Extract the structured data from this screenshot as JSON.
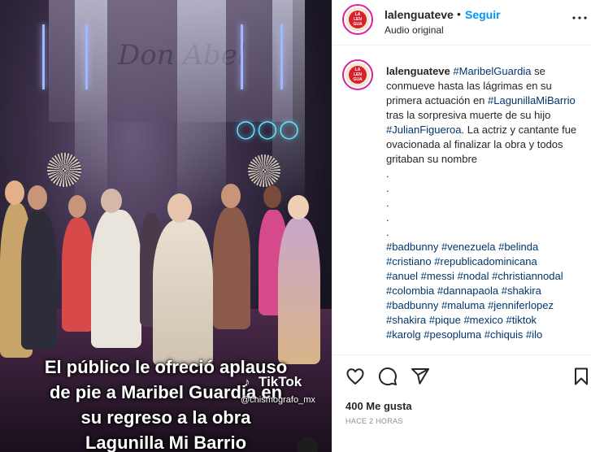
{
  "post": {
    "username": "lalenguateve",
    "follow_label": "Seguir",
    "audio_label": "Audio original",
    "caption_body": " se conmueve hasta las lágrimas en su primera actuación en ",
    "caption_mid": " tras la sorpresiva muerte de su hijo ",
    "caption_end": ". La actriz y cantante fue ovacionada al finalizar la obra y todos gritaban su nombre",
    "tag_maribel": "#MaribelGuardia",
    "tag_lagunilla": "#LagunillaMiBarrio",
    "tag_julian": "#JulianFigueroa",
    "dots": [
      ".",
      ".",
      ".",
      ".",
      "."
    ],
    "hashtag_lines": [
      [
        "#badbunny",
        "#venezuela",
        "#belinda"
      ],
      [
        "#cristiano",
        "#republicadominicana"
      ],
      [
        "#anuel",
        "#messi",
        "#nodal",
        "#christiannodal"
      ],
      [
        "#colombia",
        "#dannapaola",
        "#shakira"
      ],
      [
        "#badbunny",
        "#maluma",
        "#jenniferlopez"
      ],
      [
        "#shakira",
        "#pique",
        "#mexico",
        "#tiktok"
      ],
      [
        "#karolg",
        "#pesopluma",
        "#chiquis",
        "#ilo"
      ]
    ],
    "likes": "400 Me gusta",
    "time": "HACE 2 HORAS"
  },
  "avatar_logo_text": [
    "LA",
    "LEN",
    "GUA"
  ],
  "video": {
    "caption_lines": [
      "El público le ofreció aplauso",
      "de pie a Maribel Guardia en",
      "su regreso a la obra",
      "Lagunilla Mi Barrio"
    ],
    "sign_text": "Don Abel",
    "watermark": "TikTok",
    "watermark_handle": "@chismografo_mx"
  },
  "colors": {
    "accent_link": "#0095f6",
    "hashtag": "#00376b",
    "story_ring": "#d6249f",
    "logo_red": "#d8202a"
  },
  "icons": [
    "more-options-icon",
    "heart-icon",
    "comment-icon",
    "share-icon",
    "bookmark-icon",
    "tiktok-icon",
    "mute-icon"
  ]
}
